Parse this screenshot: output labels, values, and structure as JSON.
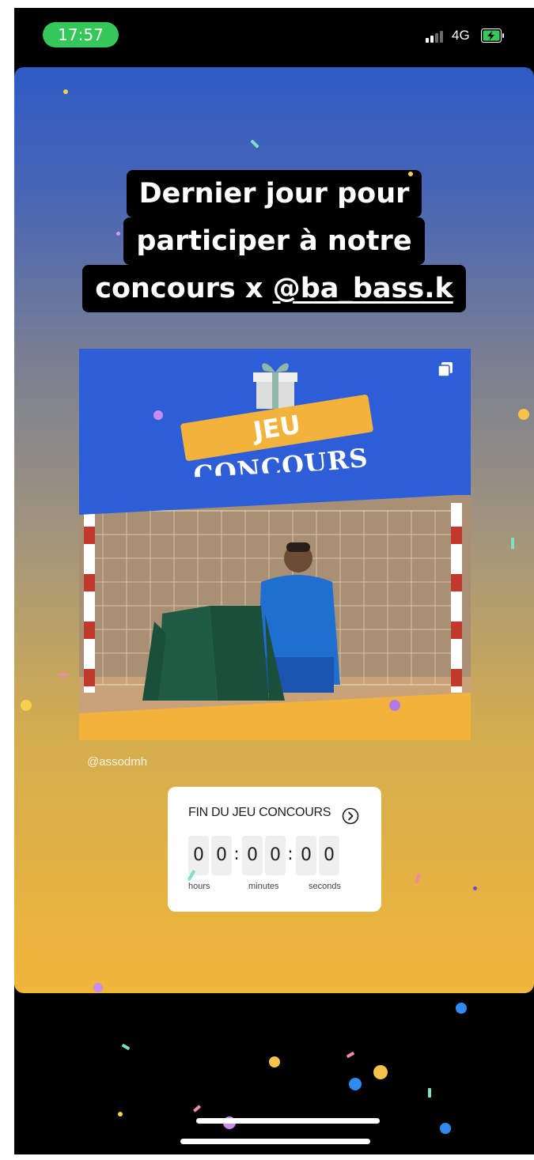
{
  "status_bar": {
    "time": "17:57",
    "network": "4G",
    "time_pill_color": "#34c759"
  },
  "story": {
    "headline_lines": [
      "Dernier jour pour",
      "participer à notre",
      "concours x "
    ],
    "headline_mention": "@ba_bass.k",
    "post": {
      "banner_top": "JEU",
      "banner_bottom": "CONCOURS",
      "credit": "@assodmh"
    },
    "countdown": {
      "title": "FIN DU JEU CONCOURS",
      "hours": [
        "0",
        "0"
      ],
      "minutes": [
        "0",
        "0"
      ],
      "seconds": [
        "0",
        "0"
      ],
      "labels": {
        "hours": "hours",
        "minutes": "minutes",
        "seconds": "seconds"
      }
    }
  },
  "colors": {
    "story_top": "#2e5bc5",
    "story_bottom": "#f1b63a",
    "banner_yellow": "#f2b23c",
    "post_blue": "#2d5ed8"
  }
}
